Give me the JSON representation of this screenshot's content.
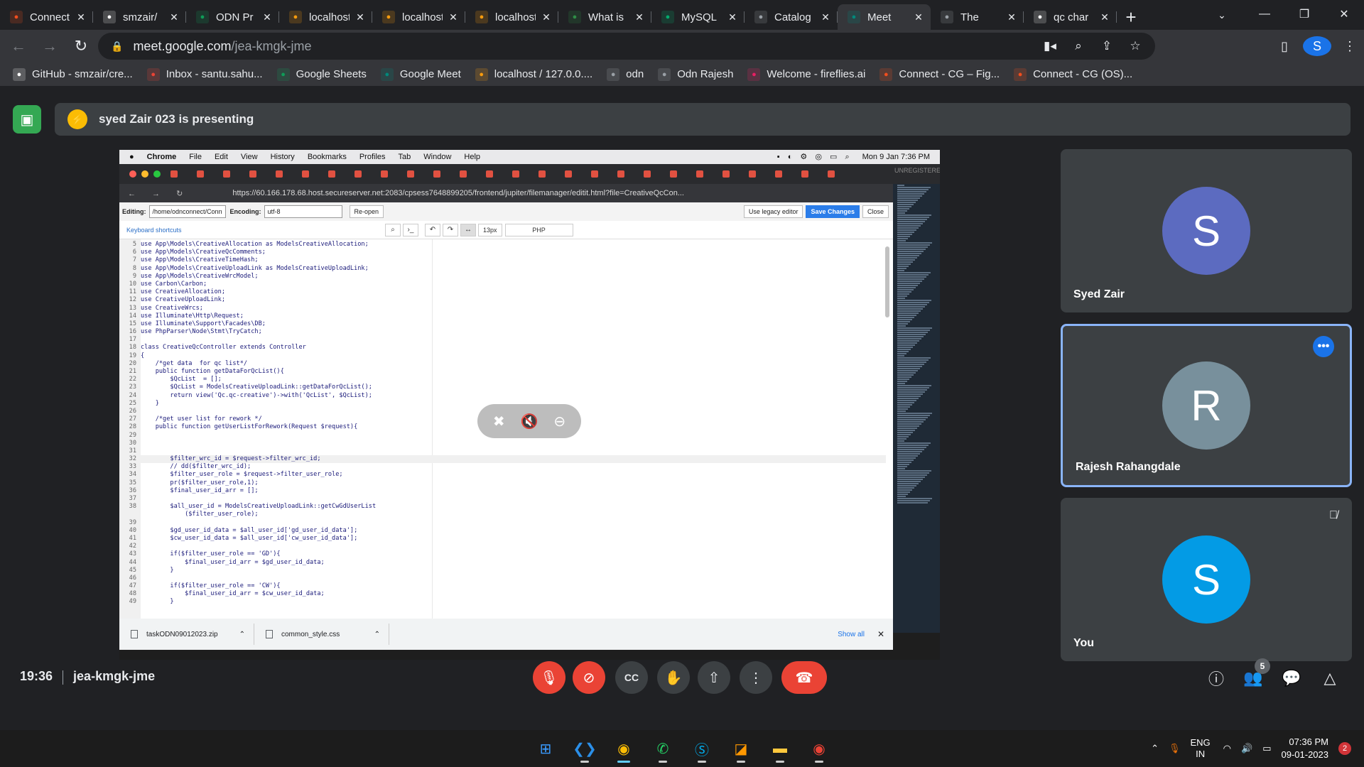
{
  "browser": {
    "tabs": [
      {
        "title": "Connect",
        "icon": "figma-icon",
        "color": "#f24e1e"
      },
      {
        "title": "smzair/",
        "icon": "github-icon",
        "color": "#ffffff"
      },
      {
        "title": "ODN Pr",
        "icon": "google-sheets-icon",
        "color": "#0f9d58"
      },
      {
        "title": "localhost",
        "icon": "phpmyadmin-icon",
        "color": "#f89c0e"
      },
      {
        "title": "localhost",
        "icon": "phpmyadmin-icon",
        "color": "#f89c0e"
      },
      {
        "title": "localhost",
        "icon": "phpmyadmin-icon",
        "color": "#f89c0e"
      },
      {
        "title": "What is",
        "icon": "gfg-icon",
        "color": "#2f8d46"
      },
      {
        "title": "MySQL",
        "icon": "w3schools-icon",
        "color": "#04aa6d"
      },
      {
        "title": "Catalog",
        "icon": "globe-icon",
        "color": "#9aa0a6"
      },
      {
        "title": "Meet",
        "icon": "google-meet-icon",
        "color": "#00897b",
        "active": true
      },
      {
        "title": "The",
        "icon": "globe-icon",
        "color": "#9aa0a6"
      },
      {
        "title": "qc char",
        "icon": "github-icon",
        "color": "#ffffff"
      }
    ],
    "url_host": "meet.google.com",
    "url_path": "/jea-kmgk-jme",
    "profile_initial": "S",
    "bookmarks": [
      {
        "label": "GitHub - smzair/cre...",
        "icon": "github-icon",
        "color": "#ffffff"
      },
      {
        "label": "Inbox - santu.sahu...",
        "icon": "gmail-icon",
        "color": "#ea4335"
      },
      {
        "label": "Google Sheets",
        "icon": "google-sheets-icon",
        "color": "#0f9d58"
      },
      {
        "label": "Google Meet",
        "icon": "google-meet-icon",
        "color": "#00897b"
      },
      {
        "label": "localhost / 127.0.0....",
        "icon": "phpmyadmin-icon",
        "color": "#f89c0e"
      },
      {
        "label": "odn",
        "icon": "globe-icon",
        "color": "#9aa0a6"
      },
      {
        "label": "Odn Rajesh",
        "icon": "globe-icon",
        "color": "#9aa0a6"
      },
      {
        "label": "Welcome - fireflies.ai",
        "icon": "fireflies-icon",
        "color": "#e91e63"
      },
      {
        "label": "Connect - CG – Fig...",
        "icon": "figma-icon",
        "color": "#f24e1e"
      },
      {
        "label": "Connect - CG (OS)...",
        "icon": "figma-icon",
        "color": "#f24e1e"
      }
    ]
  },
  "meet": {
    "presenting_banner": "syed Zair 023 is presenting",
    "time": "19:36",
    "meeting_code": "jea-kmgk-jme",
    "participant_count": "5",
    "participants": [
      {
        "name": "Syed Zair",
        "initial": "S",
        "color": "#5c6bc0"
      },
      {
        "name": "Rajesh Rahangdale",
        "initial": "R",
        "color": "#78909c"
      },
      {
        "name": "You",
        "initial": "S",
        "color": "#039be5"
      }
    ]
  },
  "shared_screen": {
    "mac_menu": [
      "Chrome",
      "File",
      "Edit",
      "View",
      "History",
      "Bookmarks",
      "Profiles",
      "Tab",
      "Window",
      "Help"
    ],
    "mac_clock": "Mon 9 Jan  7:36 PM",
    "unregistered": "UNREGISTERED",
    "url": "https://60.166.178.68.host.secureserver.net:2083/cpsess7648899205/frontend/jupiter/filemanager/editit.html?file=CreativeQcCon...",
    "editing_label": "Editing:",
    "editing_path": "/home/odnconnect/Conn",
    "encoding_label": "Encoding:",
    "encoding_value": "utf-8",
    "reopen": "Re-open",
    "legacy": "Use legacy editor",
    "save": "Save Changes",
    "close": "Close",
    "shortcuts": "Keyboard shortcuts",
    "font_size": "13px",
    "language": "PHP",
    "code_lines": [
      {
        "n": "5",
        "t": "use App\\Models\\CreativeAllocation as ModelsCreativeAllocation;"
      },
      {
        "n": "6",
        "t": "use App\\Models\\CreativeQcComments;"
      },
      {
        "n": "7",
        "t": "use App\\Models\\CreativeTimeHash;"
      },
      {
        "n": "8",
        "t": "use App\\Models\\CreativeUploadLink as ModelsCreativeUploadLink;"
      },
      {
        "n": "9",
        "t": "use App\\Models\\CreativeWrcModel;"
      },
      {
        "n": "10",
        "t": "use Carbon\\Carbon;"
      },
      {
        "n": "11",
        "t": "use CreativeAllocation;"
      },
      {
        "n": "12",
        "t": "use CreativeUploadLink;"
      },
      {
        "n": "13",
        "t": "use CreativeWrcs;"
      },
      {
        "n": "14",
        "t": "use Illuminate\\Http\\Request;"
      },
      {
        "n": "15",
        "t": "use Illuminate\\Support\\Facades\\DB;"
      },
      {
        "n": "16",
        "t": "use PhpParser\\Node\\Stmt\\TryCatch;"
      },
      {
        "n": "17",
        "t": ""
      },
      {
        "n": "18",
        "t": "class CreativeQcController extends Controller"
      },
      {
        "n": "19",
        "t": "{"
      },
      {
        "n": "20",
        "t": "    /*get data  for qc list*/"
      },
      {
        "n": "21",
        "t": "    public function getDataForQcList(){"
      },
      {
        "n": "22",
        "t": "        $QcList  = [];"
      },
      {
        "n": "23",
        "t": "        $QcList = ModelsCreativeUploadLink::getDataForQcList();"
      },
      {
        "n": "24",
        "t": "        return view('Qc.qc-creative')->with('QcList', $QcList);"
      },
      {
        "n": "25",
        "t": "    }"
      },
      {
        "n": "26",
        "t": ""
      },
      {
        "n": "27",
        "t": "    /*get user list for rework */"
      },
      {
        "n": "28",
        "t": "    public function getUserListForRework(Request $request){"
      },
      {
        "n": "29",
        "t": ""
      },
      {
        "n": "30",
        "t": ""
      },
      {
        "n": "31",
        "t": ""
      },
      {
        "n": "32",
        "t": "        $filter_wrc_id = $request->filter_wrc_id;"
      },
      {
        "n": "33",
        "t": "        // dd($filter_wrc_id);"
      },
      {
        "n": "34",
        "t": "        $filter_user_role = $request->filter_user_role;"
      },
      {
        "n": "35",
        "t": "        pr($filter_user_role,1);"
      },
      {
        "n": "36",
        "t": "        $final_user_id_arr = [];"
      },
      {
        "n": "37",
        "t": ""
      },
      {
        "n": "38",
        "t": "        $all_user_id = ModelsCreativeUploadLink::getCwGdUserList"
      },
      {
        "n": "",
        "t": "            ($filter_user_role);"
      },
      {
        "n": "39",
        "t": ""
      },
      {
        "n": "40",
        "t": "        $gd_user_id_data = $all_user_id['gd_user_id_data'];"
      },
      {
        "n": "41",
        "t": "        $cw_user_id_data = $all_user_id['cw_user_id_data'];"
      },
      {
        "n": "42",
        "t": ""
      },
      {
        "n": "43",
        "t": "        if($filter_user_role == 'GD'){"
      },
      {
        "n": "44",
        "t": "            $final_user_id_arr = $gd_user_id_data;"
      },
      {
        "n": "45",
        "t": "        }"
      },
      {
        "n": "46",
        "t": ""
      },
      {
        "n": "47",
        "t": "        if($filter_user_role == 'CW'){"
      },
      {
        "n": "48",
        "t": "            $final_user_id_arr = $cw_user_id_data;"
      },
      {
        "n": "49",
        "t": "        }"
      }
    ],
    "downloads": [
      {
        "name": "taskODN09012023.zip"
      },
      {
        "name": "common_style.css"
      }
    ],
    "show_all": "Show all"
  },
  "taskbar": {
    "language_line1": "ENG",
    "language_line2": "IN",
    "time": "07:36 PM",
    "date": "09-01-2023",
    "notifications": "2"
  }
}
